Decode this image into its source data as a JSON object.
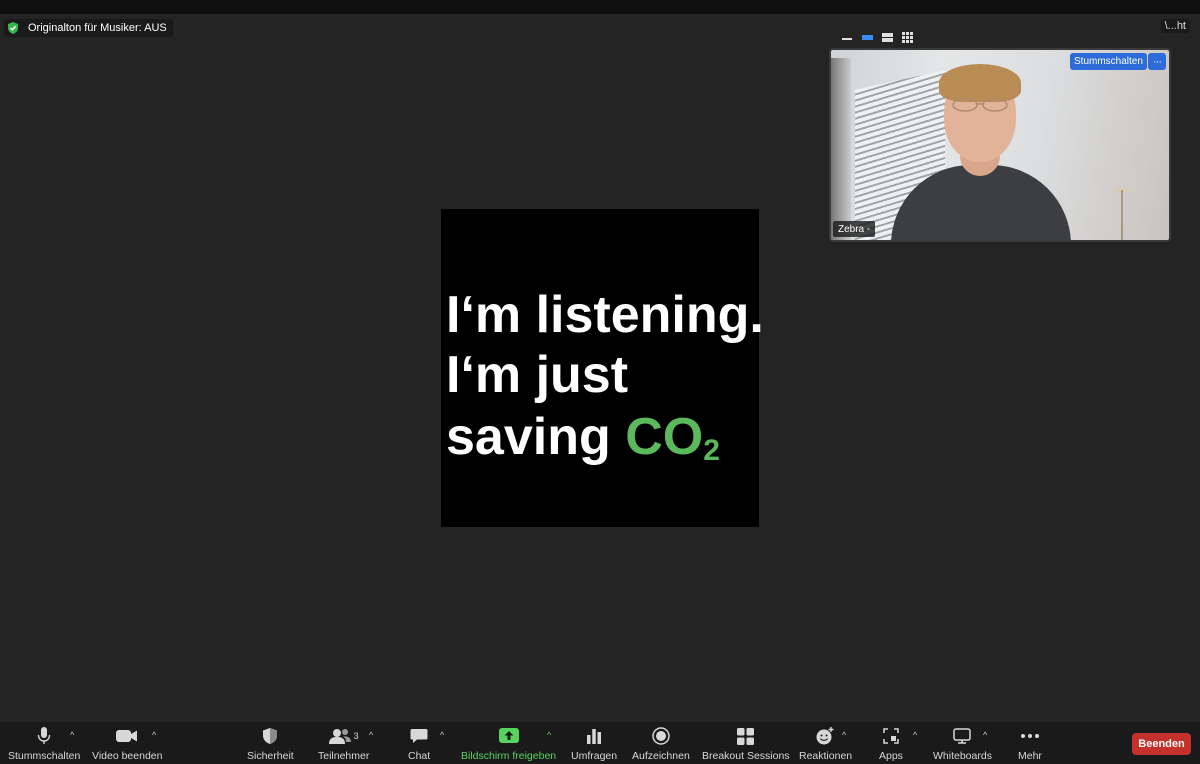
{
  "meeting": {
    "audio_banner": "Originalton für Musiker: AUS",
    "corner_text": "\\...ht"
  },
  "speaker_tile": {
    "mute_button": "Stummschalten",
    "more_button": "···",
    "name": "Zebra -"
  },
  "shared_content": {
    "line1": "I‘m listening.",
    "line2": "I‘m just",
    "line3_text": "saving ",
    "line3_highlight": "CO",
    "line3_subscript": "2",
    "highlight_color": "#5cb85c"
  },
  "toolbar": {
    "mute": "Stummschalten",
    "video": "Video beenden",
    "security": "Sicherheit",
    "participants": "Teilnehmer",
    "participants_count": "3",
    "chat": "Chat",
    "share": "Bildschirm freigeben",
    "polls": "Umfragen",
    "record": "Aufzeichnen",
    "breakout": "Breakout Sessions",
    "reactions": "Reaktionen",
    "apps": "Apps",
    "whiteboards": "Whiteboards",
    "more": "Mehr",
    "end": "Beenden",
    "caret": "^"
  },
  "colors": {
    "accent_blue": "#2d6bd9",
    "share_green": "#57d45d",
    "end_red": "#c4302b",
    "background": "#242424"
  },
  "icons": [
    "shield-check-icon",
    "microphone-icon",
    "video-camera-icon",
    "security-shield-icon",
    "participants-icon",
    "chat-bubble-icon",
    "share-screen-icon",
    "polls-icon",
    "record-icon",
    "breakout-grid-icon",
    "reactions-icon",
    "apps-icon",
    "whiteboard-icon",
    "more-dots-icon"
  ]
}
